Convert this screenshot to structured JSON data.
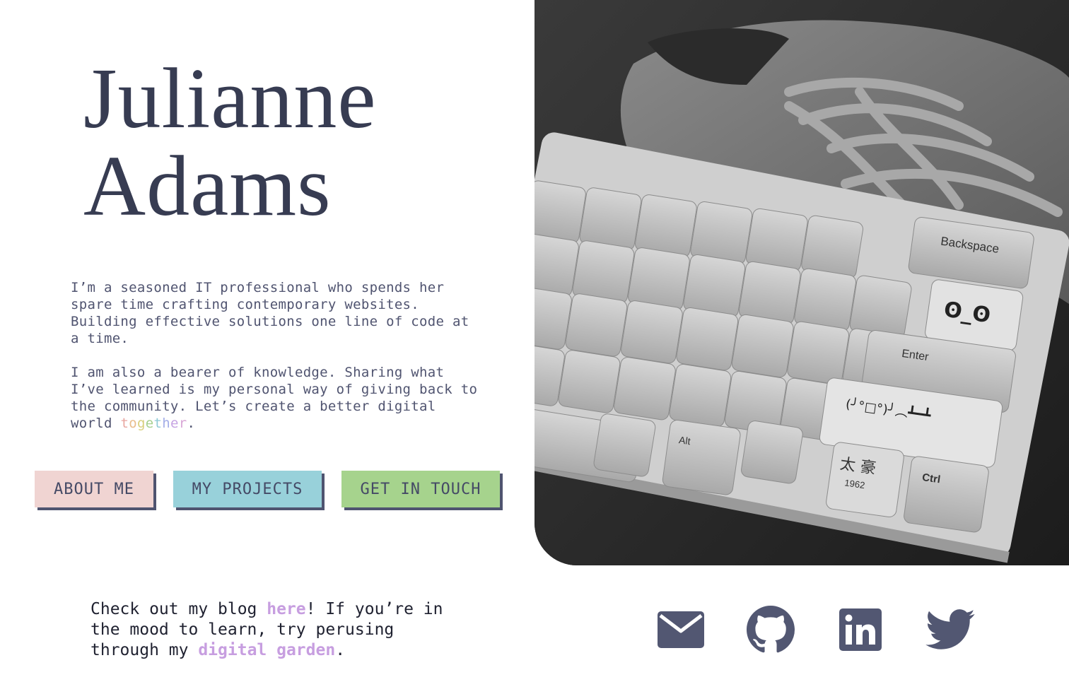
{
  "header": {
    "name_line1": "Julianne",
    "name_line2": "Adams"
  },
  "bio": {
    "paragraph1": "I’m a seasoned IT professional who spends her spare time crafting contemporary websites. Building effective solutions one line of code at a time.",
    "paragraph2_prefix": "I am also a bearer of knowledge. Sharing what I’ve learned is my personal way of giving back to the community. Let’s create a better digital world ",
    "rainbow_word": "together",
    "paragraph2_suffix": "."
  },
  "buttons": {
    "about": "ABOUT ME",
    "projects": "MY PROJECTS",
    "contact": "GET IN TOUCH"
  },
  "hero": {
    "keycaps": {
      "backspace": "Backspace",
      "enter": "Enter",
      "alt": "Alt",
      "ctrl": "Ctrl",
      "face_key": "ʘ_ʘ",
      "kaomoji": "(╯°□°)╯︵┻━┻",
      "cjk": "太 豪",
      "year": "1962"
    }
  },
  "footer": {
    "blog_prefix": "Check out my blog ",
    "blog_link": "here",
    "blog_middle": "! If you’re in the mood to learn, try perusing through my ",
    "garden_link": "digital garden",
    "blog_suffix": "."
  },
  "social": [
    {
      "name": "email",
      "icon": "mail-icon"
    },
    {
      "name": "github",
      "icon": "github-icon"
    },
    {
      "name": "linkedin",
      "icon": "linkedin-icon"
    },
    {
      "name": "twitter",
      "icon": "twitter-icon"
    }
  ],
  "colors": {
    "text_dark": "#373c52",
    "icon": "#525772",
    "link": "#c79ee0",
    "about_bg": "#f0d4d2",
    "projects_bg": "#98d1da",
    "contact_bg": "#a6d38d"
  }
}
